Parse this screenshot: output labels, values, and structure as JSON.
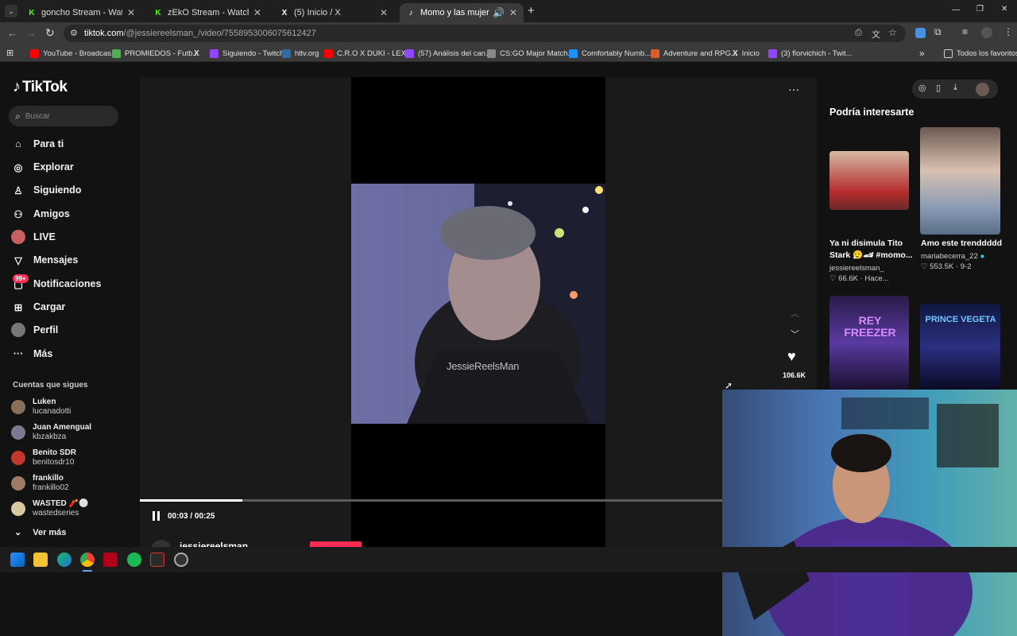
{
  "browser": {
    "tabs": [
      {
        "title": "goncho Stream - Watch Live on Kick",
        "icon_letter": "K",
        "icon_color": "#53fc18"
      },
      {
        "title": "zEkO Stream - Watch Live on Kick",
        "icon_letter": "K",
        "icon_color": "#53fc18"
      },
      {
        "title": "(5) Inicio / X",
        "icon_letter": "X",
        "icon_color": "#000000"
      },
      {
        "title": "Momo y las mujeres: Un lla",
        "icon_letter": "♪",
        "icon_color": "#000000"
      }
    ],
    "new_tab": "+",
    "url_domain": "tiktok.com",
    "url_path": "/@jessiereelsman_/video/7558953006075612427",
    "bookmarks": [
      {
        "label": "YouTube - Broadcas...",
        "color": "#ff0000"
      },
      {
        "label": "PROMIEDOS - Futb...",
        "color": "#4caf50"
      },
      {
        "label": "",
        "color": "#000000",
        "icon": "X"
      },
      {
        "label": "Siguiendo - Twitch",
        "color": "#9146ff"
      },
      {
        "label": "hltv.org",
        "color": "#2d6da3"
      },
      {
        "label": "C.R.O X DUKI - LEX...",
        "color": "#ff0000"
      },
      {
        "label": "(57) Análisis del can...",
        "color": "#9146ff"
      },
      {
        "label": "CS:GO Major Match...",
        "color": "#888888"
      },
      {
        "label": "Comfortably Numb...",
        "color": "#1e90ff"
      },
      {
        "label": "Adventure and RPG...",
        "color": "#e05a2a"
      },
      {
        "label": "Inicio",
        "color": "#000000",
        "icon": "X"
      },
      {
        "label": "(3) florvichich - Twit...",
        "color": "#9146ff"
      }
    ],
    "bookmarks_overflow": "»",
    "all_bookmarks": "Todos los favoritos",
    "window_controls": {
      "minimize": "—",
      "maximize": "❐",
      "close": "✕"
    }
  },
  "tiktok": {
    "logo": "TikTok",
    "search_placeholder": "Buscar",
    "nav": [
      {
        "label": "Para ti",
        "icon": "home-icon"
      },
      {
        "label": "Explorar",
        "icon": "compass-icon"
      },
      {
        "label": "Siguiendo",
        "icon": "following-icon"
      },
      {
        "label": "Amigos",
        "icon": "friends-icon"
      },
      {
        "label": "LIVE",
        "icon": "live-icon"
      },
      {
        "label": "Mensajes",
        "icon": "messages-icon"
      },
      {
        "label": "Notificaciones",
        "icon": "notifications-icon",
        "badge": "99+"
      },
      {
        "label": "Cargar",
        "icon": "upload-icon"
      },
      {
        "label": "Perfil",
        "icon": "profile-icon"
      },
      {
        "label": "Más",
        "icon": "more-icon"
      }
    ],
    "following_title": "Cuentas que sigues",
    "following": [
      {
        "name": "Luken",
        "user": "lucanadotti",
        "color": "#8a6f5a"
      },
      {
        "name": "Juan Amengual",
        "user": "kbzakbza",
        "color": "#7a7a90"
      },
      {
        "name": "Benito SDR",
        "user": "benitosdr10",
        "color": "#c0392b"
      },
      {
        "name": "frankillo",
        "user": "frankillo02",
        "color": "#a07a66"
      },
      {
        "name": "WASTED 🧨⚪",
        "user": "wastedseries",
        "color": "#d8c8a0"
      }
    ],
    "see_more": "Ver más",
    "video": {
      "watermark": "JessieReelsMan",
      "time": "00:03 / 00:25",
      "progress": 0.175,
      "likes": "106.6K",
      "author": "jessiereelsman_"
    },
    "recommended_title": "Podría interesarte",
    "recommended": [
      {
        "caption": "Ya ni disimula Tito Stark 😮‍💨🏎 #momo...",
        "author": "jessiereelsman_",
        "stats": "66.6K · Hace..."
      },
      {
        "caption": "Amo este trenddddd",
        "author": "mariabecerra_22",
        "stats": "553.5K · 9-2"
      },
      {
        "caption": "",
        "overlay": "REY FREEZER",
        "author": "",
        "stats": ""
      },
      {
        "caption": "",
        "overlay": "PRINCE VEGETA",
        "author": "",
        "stats": ""
      }
    ]
  }
}
